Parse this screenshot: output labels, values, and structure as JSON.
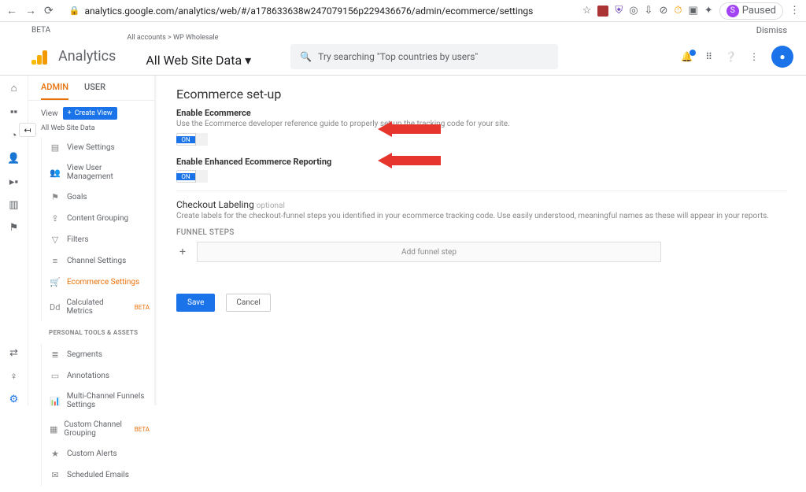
{
  "browser": {
    "url": "analytics.google.com/analytics/web/#/a178633638w247079156p229436676/admin/ecommerce/settings",
    "paused": "Paused",
    "avatar_initial": "S"
  },
  "top_strip": {
    "beta": "BETA",
    "dismiss": "Dismiss"
  },
  "header": {
    "product": "Analytics",
    "breadcrumb": "All accounts > WP Wholesale",
    "view_name": "All Web Site Data",
    "search_placeholder": "Try searching \"Top countries by users\""
  },
  "tabs": {
    "admin": "ADMIN",
    "user": "USER"
  },
  "view_col": {
    "label": "View",
    "create": "Create View",
    "selected": "All Web Site Data",
    "items": [
      {
        "icon": "▤",
        "label": "View Settings"
      },
      {
        "icon": "👥",
        "label": "View User Management"
      },
      {
        "icon": "⚑",
        "label": "Goals"
      },
      {
        "icon": "⇪",
        "label": "Content Grouping"
      },
      {
        "icon": "▽",
        "label": "Filters"
      },
      {
        "icon": "≡",
        "label": "Channel Settings"
      },
      {
        "icon": "🛒",
        "label": "Ecommerce Settings"
      },
      {
        "icon": "Dd",
        "label": "Calculated Metrics",
        "beta": "BETA"
      }
    ],
    "section": "PERSONAL TOOLS & ASSETS",
    "items2": [
      {
        "icon": "≣",
        "label": "Segments"
      },
      {
        "icon": "▭",
        "label": "Annotations"
      },
      {
        "icon": "📊",
        "label": "Multi-Channel Funnels Settings"
      },
      {
        "icon": "▦",
        "label": "Custom Channel Grouping",
        "beta": "BETA"
      },
      {
        "icon": "★",
        "label": "Custom Alerts"
      },
      {
        "icon": "✉",
        "label": "Scheduled Emails"
      }
    ]
  },
  "main": {
    "title": "Ecommerce set-up",
    "s1_title": "Enable Ecommerce",
    "s1_desc": "Use the Ecommerce developer reference guide to properly set-up the tracking code for your site.",
    "toggle_on": "ON",
    "s2_title": "Enable Enhanced Ecommerce Reporting",
    "checkout_title": "Checkout Labeling",
    "optional": "optional",
    "checkout_desc": "Create labels for the checkout-funnel steps you identified in your ecommerce tracking code. Use easily understood, meaningful names as these will appear in your reports.",
    "funnel_head": "FUNNEL STEPS",
    "add_step": "Add funnel step",
    "save": "Save",
    "cancel": "Cancel"
  }
}
